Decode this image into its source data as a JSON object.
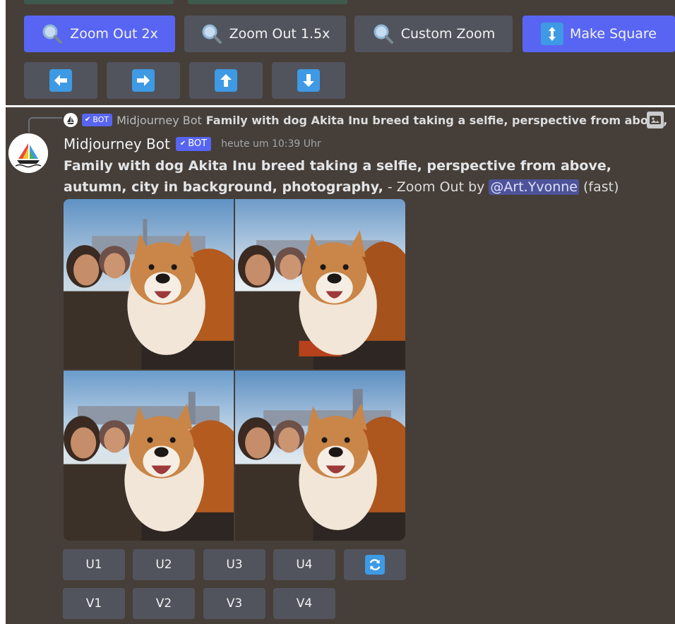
{
  "top_buttons": [
    {
      "label": "Zoom Out 2x",
      "icon": "magnifier-icon",
      "style": "primary"
    },
    {
      "label": "Zoom Out 1.5x",
      "icon": "magnifier-icon",
      "style": "secondary"
    },
    {
      "label": "Custom Zoom",
      "icon": "magnifier-icon",
      "style": "secondary"
    },
    {
      "label": "Make Square",
      "icon": "up-down-arrow-icon",
      "style": "primary"
    }
  ],
  "pan_buttons": [
    {
      "icon": "arrow-left-icon"
    },
    {
      "icon": "arrow-right-icon"
    },
    {
      "icon": "arrow-up-icon"
    },
    {
      "icon": "arrow-down-icon"
    }
  ],
  "reply": {
    "bot_tag": "BOT",
    "user": "Midjourney Bot",
    "content": "Family with dog Akita Inu breed taking a selfie, perspective from above,"
  },
  "message": {
    "author": "Midjourney Bot",
    "bot_tag": "BOT",
    "timestamp": "heute um 10:39 Uhr",
    "prompt": "Family with dog Akita Inu breed taking a selfie, perspective from above, autumn, city in background, photography,",
    "separator": " - ",
    "mode_text": "Zoom Out by",
    "mention": "@Art.Yvonne",
    "speed": " (fast)"
  },
  "upscale_buttons": [
    "U1",
    "U2",
    "U3",
    "U4"
  ],
  "variation_buttons": [
    "V1",
    "V2",
    "V3",
    "V4"
  ],
  "reroll_icon": "refresh-icon",
  "colors": {
    "primary": "#5865f2",
    "secondary": "#51545c",
    "background": "#463e38",
    "mention": "#4d5398"
  }
}
